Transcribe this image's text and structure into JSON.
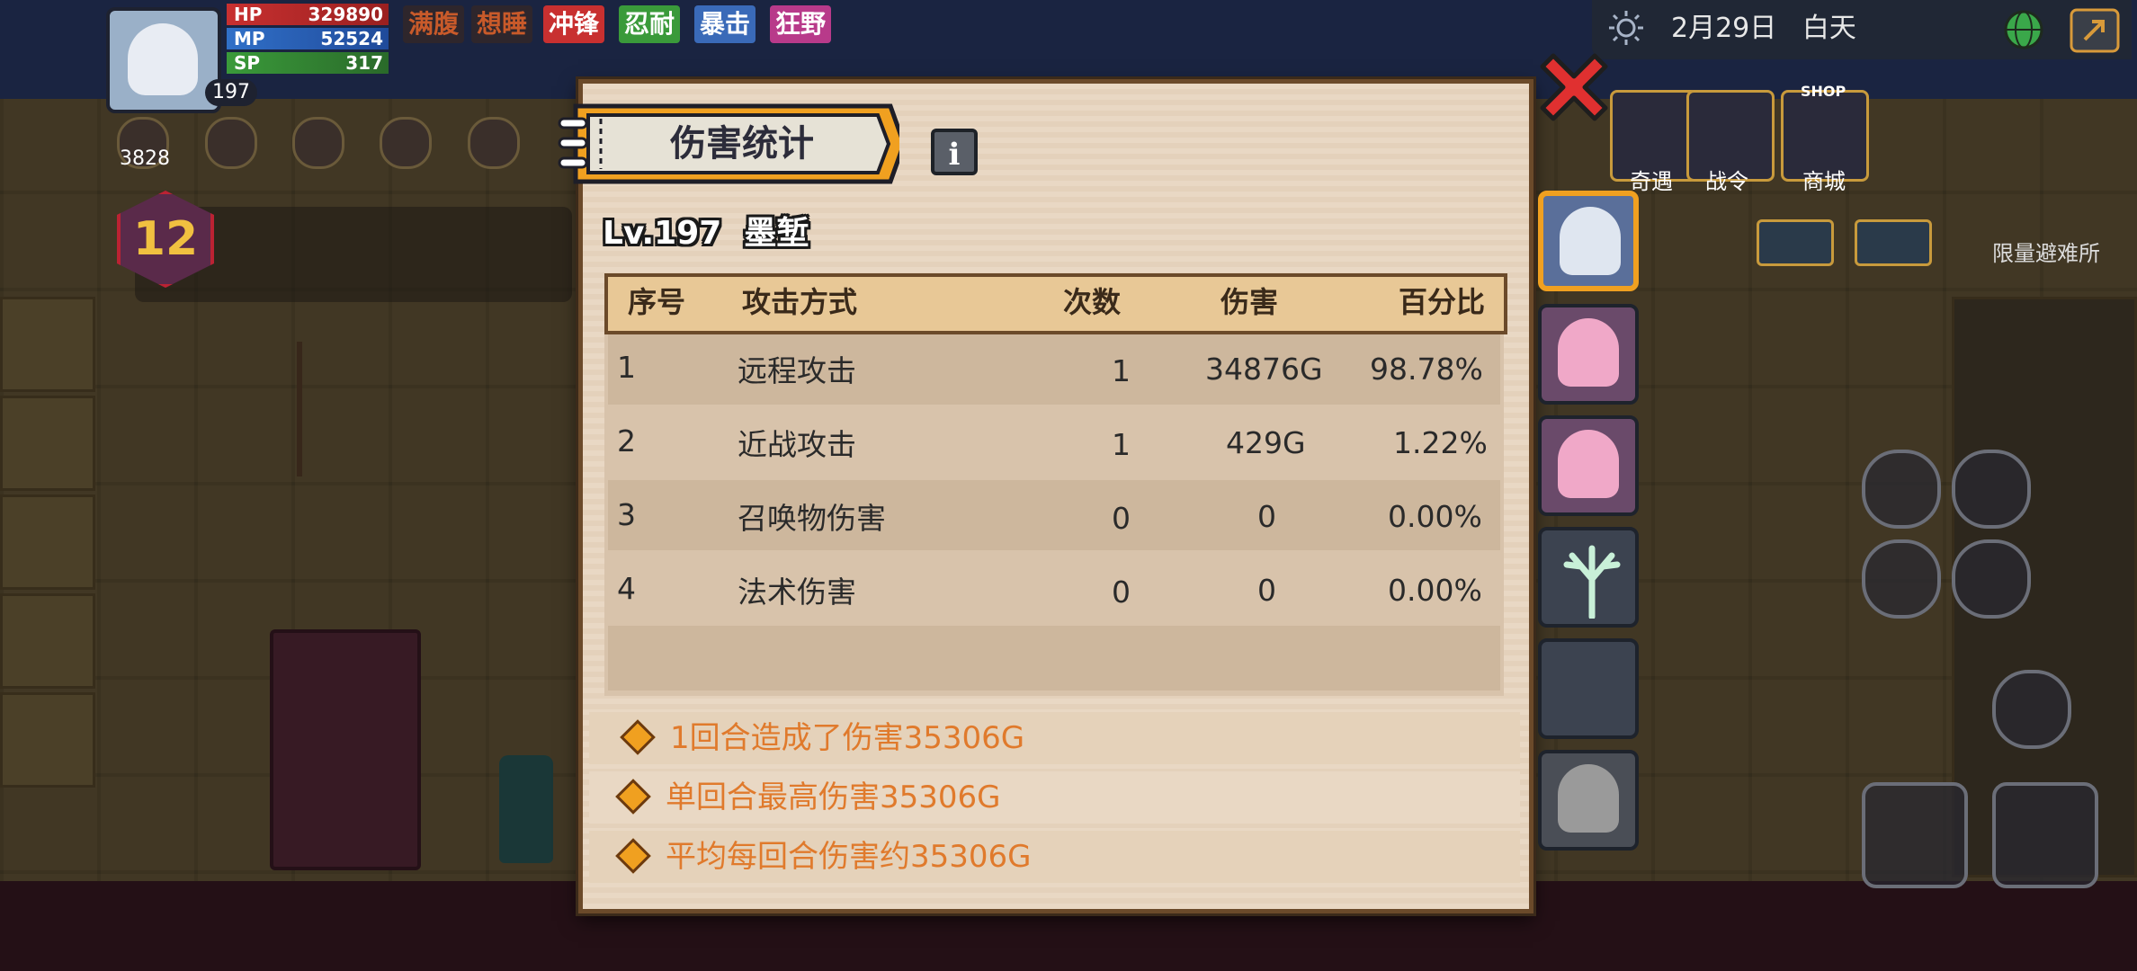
{
  "hud": {
    "player_level": "197",
    "hp_label": "HP",
    "hp_value": "329890",
    "mp_label": "MP",
    "mp_value": "52524",
    "sp_label": "SP",
    "sp_value": "317",
    "buffs": [
      {
        "label": "满腹",
        "color": "#c85a2a"
      },
      {
        "label": "想睡",
        "color": "#c85a2a"
      },
      {
        "label": "冲锋",
        "color": "#d83030"
      },
      {
        "label": "忍耐",
        "color": "#3a9a3a"
      },
      {
        "label": "暴击",
        "color": "#3a6ab8"
      },
      {
        "label": "狂野",
        "color": "#b83a8a"
      }
    ],
    "gold_count": "3828",
    "floor_badge": "12",
    "date": "2月29日",
    "time_of_day": "白天",
    "side_label": "限量避难所",
    "menu_labels": [
      "奇遇",
      "战令",
      "商城"
    ],
    "shop_tag": "SHOP"
  },
  "dialog": {
    "title": "伤害统计",
    "info_glyph": "i",
    "player_level": "Lv.197",
    "player_name": "墨堑",
    "columns": [
      "序号",
      "攻击方式",
      "次数",
      "伤害",
      "百分比"
    ],
    "rows": [
      {
        "id": "1",
        "type": "远程攻击",
        "count": "1",
        "damage": "34876G",
        "percent": "98.78%"
      },
      {
        "id": "2",
        "type": "近战攻击",
        "count": "1",
        "damage": "429G",
        "percent": "1.22%"
      },
      {
        "id": "3",
        "type": "召唤物伤害",
        "count": "0",
        "damage": "0",
        "percent": "0.00%"
      },
      {
        "id": "4",
        "type": "法术伤害",
        "count": "0",
        "damage": "0",
        "percent": "0.00%"
      }
    ],
    "summary": [
      "1回合造成了伤害35306G",
      "单回合最高伤害35306G",
      "平均每回合伤害约35306G"
    ]
  },
  "characters": [
    {
      "name": "hero",
      "color": "#dfe6f0",
      "selected": true
    },
    {
      "name": "nurse-a",
      "color": "#f0a8c8",
      "selected": false
    },
    {
      "name": "nurse-b",
      "color": "#f0a8c8",
      "selected": false
    },
    {
      "name": "antler-spirit",
      "color": "#c8f0d8",
      "selected": false
    },
    {
      "name": "empty",
      "color": "#3c4350",
      "selected": false
    },
    {
      "name": "locked-maid",
      "color": "#9a9a9a",
      "selected": false
    }
  ],
  "colors": {
    "accent_orange": "#e07a2c",
    "close_red": "#e03030",
    "frame_brown": "#6b4a2a"
  }
}
